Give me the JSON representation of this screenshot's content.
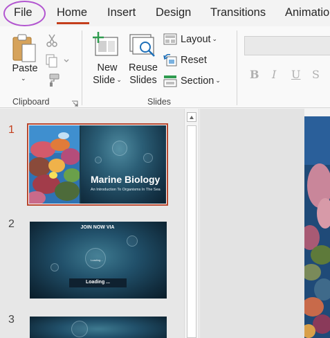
{
  "tabs": [
    {
      "label": "File"
    },
    {
      "label": "Home"
    },
    {
      "label": "Insert"
    },
    {
      "label": "Design"
    },
    {
      "label": "Transitions"
    },
    {
      "label": "Animatio"
    }
  ],
  "active_tab": "Home",
  "ribbon": {
    "clipboard": {
      "paste_label": "Paste",
      "group_label": "Clipboard"
    },
    "slides": {
      "new_slide_line1": "New",
      "new_slide_line2": "Slide",
      "reuse_slides_line1": "Reuse",
      "reuse_slides_line2": "Slides",
      "layout_label": "Layout",
      "reset_label": "Reset",
      "section_label": "Section",
      "group_label": "Slides"
    },
    "font": {
      "bold": "B",
      "italic": "I",
      "underline": "U",
      "strikethrough": "S"
    }
  },
  "thumbnails": [
    {
      "number": "1",
      "title": "Marine Biology",
      "subtitle": "An Introduction To Organisms In The Sea"
    },
    {
      "number": "2",
      "title": "JOIN NOW VIA",
      "loading_small": "Loading...",
      "loading_bar": "Loading ..."
    },
    {
      "number": "3"
    }
  ],
  "colors": {
    "accent": "#c43e1c",
    "file_highlight": "#b255d0"
  }
}
